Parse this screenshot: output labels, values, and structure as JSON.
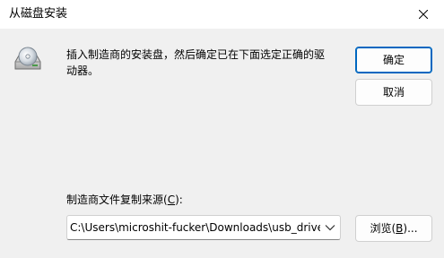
{
  "window": {
    "title": "从磁盘安装",
    "close_label": "×"
  },
  "message": "插入制造商的安装盘，然后确定已在下面选定正确的驱动器。",
  "buttons": {
    "ok": "确定",
    "cancel": "取消",
    "browse_prefix": "浏览(",
    "browse_key": "B",
    "browse_suffix": ")..."
  },
  "source": {
    "label_prefix": "制造商文件复制来源(",
    "label_key": "C",
    "label_suffix": "):",
    "path_value": "C:\\Users\\microshit-fucker\\Downloads\\usb_driver"
  },
  "icons": {
    "disk": "disk-drive-icon",
    "close": "close-icon",
    "dropdown": "chevron-down-icon"
  },
  "colors": {
    "accent": "#0067c0",
    "dialog_bg": "#f0f0f0",
    "titlebar_bg": "#ffffff"
  }
}
